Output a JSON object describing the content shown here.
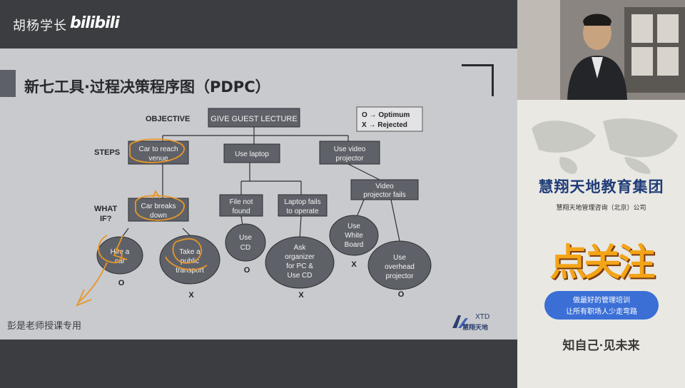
{
  "header": {
    "channel_name": "胡杨学长",
    "platform_logo": "bilibili"
  },
  "slide": {
    "title": "新七工具·过程决策程序图（PDPC）",
    "labels": {
      "objective": "OBJECTIVE",
      "steps": "STEPS",
      "what_if_1": "WHAT",
      "what_if_2": "IF?"
    },
    "legend": {
      "optimum": "O → Optimum",
      "rejected": "X → Rejected"
    },
    "objective_box": "GIVE GUEST LECTURE",
    "steps": [
      {
        "line1": "Car to reach",
        "line2": "venue"
      },
      {
        "line1": "Use laptop",
        "line2": ""
      },
      {
        "line1": "Use video",
        "line2": "projector"
      }
    ],
    "whatifs": [
      {
        "line1": "Car breaks",
        "line2": "down"
      },
      {
        "line1": "File not",
        "line2": "found"
      },
      {
        "line1": "Laptop fails",
        "line2": "to operate"
      },
      {
        "line1": "Video",
        "line2": "projector fails"
      }
    ],
    "solutions": [
      {
        "l1": "Hire a",
        "l2": "car",
        "l3": "",
        "mark": "O"
      },
      {
        "l1": "Take a",
        "l2": "public",
        "l3": "transport",
        "mark": "X"
      },
      {
        "l1": "Use",
        "l2": "CD",
        "l3": "",
        "mark": "O"
      },
      {
        "l1": "Ask",
        "l2": "organizer",
        "l3": "for PC &",
        "l4": "Use CD",
        "mark": "X"
      },
      {
        "l1": "Use",
        "l2": "White",
        "l3": "Board",
        "mark": "X"
      },
      {
        "l1": "Use",
        "l2": "overhead",
        "l3": "projector",
        "mark": "O"
      }
    ],
    "watermark": "彭是老师授课专用",
    "logo_text": "XTD",
    "logo_name": "慧翔天地"
  },
  "sidebar_ad": {
    "group_name": "慧翔天地教育集团",
    "subtitle": "慧翔天地管理咨询（北京）公司",
    "big_text": "点关注",
    "ribbon_line1": "做最好的管理培训",
    "ribbon_line2": "让所有职场人少走弯路",
    "motto": "知自己·见未来"
  },
  "colors": {
    "accent_blue": "#1f3c78",
    "slide_bg": "#c9cacd",
    "box_fill": "#5f6168",
    "annotation": "#e8962a"
  }
}
